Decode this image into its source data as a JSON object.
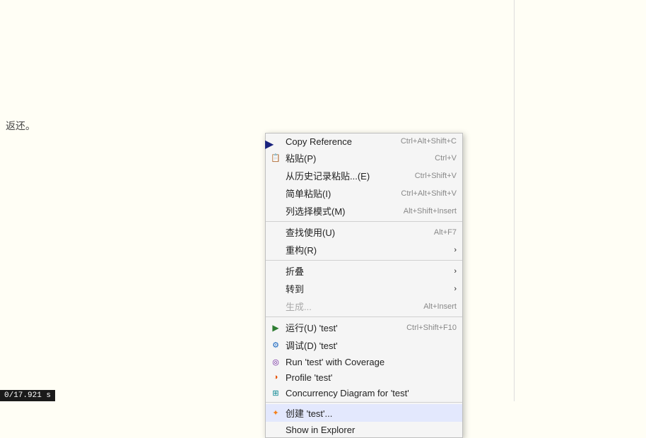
{
  "background": {
    "hint_text": "返还。"
  },
  "status_bar": {
    "text": "0/17.921 s"
  },
  "context_menu": {
    "items": [
      {
        "id": "copy-reference",
        "label": "Copy Reference",
        "shortcut": "Ctrl+Alt+Shift+C",
        "icon": "",
        "has_arrow": false,
        "disabled": false,
        "separator_after": false
      },
      {
        "id": "paste",
        "label": "粘贴(P)",
        "shortcut": "Ctrl+V",
        "icon": "paste",
        "has_arrow": false,
        "disabled": false,
        "separator_after": false
      },
      {
        "id": "paste-history",
        "label": "从历史记录粘贴...(E)",
        "shortcut": "Ctrl+Shift+V",
        "icon": "",
        "has_arrow": false,
        "disabled": false,
        "separator_after": false
      },
      {
        "id": "paste-simple",
        "label": "简单粘贴(I)",
        "shortcut": "Ctrl+Alt+Shift+V",
        "icon": "",
        "has_arrow": false,
        "disabled": false,
        "separator_after": false
      },
      {
        "id": "column-select",
        "label": "列选择模式(M)",
        "shortcut": "Alt+Shift+Insert",
        "icon": "",
        "has_arrow": false,
        "disabled": false,
        "separator_after": true
      },
      {
        "id": "find-usages",
        "label": "查找使用(U)",
        "shortcut": "Alt+F7",
        "icon": "",
        "has_arrow": false,
        "disabled": false,
        "separator_after": false
      },
      {
        "id": "refactor",
        "label": "重构(R)",
        "shortcut": "",
        "icon": "",
        "has_arrow": true,
        "disabled": false,
        "separator_after": true
      },
      {
        "id": "fold",
        "label": "折叠",
        "shortcut": "",
        "icon": "",
        "has_arrow": true,
        "disabled": false,
        "separator_after": false
      },
      {
        "id": "goto",
        "label": "转到",
        "shortcut": "",
        "icon": "",
        "has_arrow": true,
        "disabled": false,
        "separator_after": false
      },
      {
        "id": "generate",
        "label": "生成...",
        "shortcut": "Alt+Insert",
        "icon": "",
        "has_arrow": false,
        "disabled": true,
        "separator_after": true
      },
      {
        "id": "run",
        "label": "运行(U) 'test'",
        "shortcut": "Ctrl+Shift+F10",
        "icon": "run",
        "has_arrow": false,
        "disabled": false,
        "separator_after": false
      },
      {
        "id": "debug",
        "label": "调试(D) 'test'",
        "shortcut": "",
        "icon": "gear",
        "has_arrow": false,
        "disabled": false,
        "separator_after": false
      },
      {
        "id": "run-coverage",
        "label": "Run 'test' with Coverage",
        "shortcut": "",
        "icon": "cov",
        "has_arrow": false,
        "disabled": false,
        "separator_after": false
      },
      {
        "id": "profile",
        "label": "Profile 'test'",
        "shortcut": "",
        "icon": "prof",
        "has_arrow": false,
        "disabled": false,
        "separator_after": false
      },
      {
        "id": "concurrency",
        "label": "Concurrency Diagram for 'test'",
        "shortcut": "",
        "icon": "conc",
        "has_arrow": false,
        "disabled": false,
        "separator_after": true
      },
      {
        "id": "create",
        "label": "创建 'test'...",
        "shortcut": "",
        "icon": "create",
        "has_arrow": false,
        "disabled": false,
        "separator_after": false,
        "highlighted": true
      },
      {
        "id": "show-in-explorer",
        "label": "Show in Explorer",
        "shortcut": "",
        "icon": "",
        "has_arrow": false,
        "disabled": false,
        "separator_after": false
      }
    ]
  }
}
